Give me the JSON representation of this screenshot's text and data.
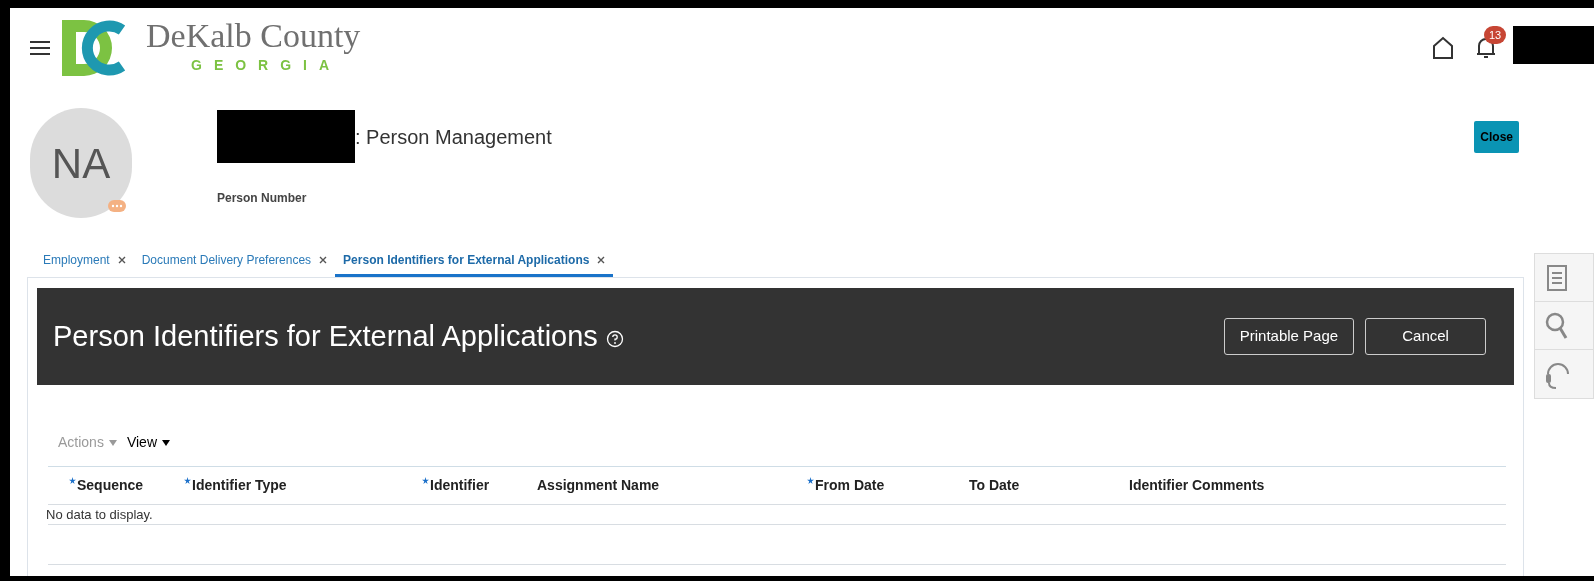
{
  "header": {
    "logo": {
      "name": "DeKalb County",
      "state": "GEORGIA"
    },
    "notifications": {
      "count": "13"
    }
  },
  "person": {
    "initials": "NA",
    "title": ": Person Management",
    "number_label": "Person Number",
    "close_button": "Close"
  },
  "tabs": [
    {
      "label": "Employment",
      "selected": false
    },
    {
      "label": "Document Delivery Preferences",
      "selected": false
    },
    {
      "label": "Person Identifiers for External Applications",
      "selected": true
    }
  ],
  "page": {
    "title": "Person Identifiers for External Applications",
    "buttons": [
      "Printable Page",
      "Cancel"
    ]
  },
  "toolbar": {
    "actions": {
      "label": "Actions",
      "disabled": true
    },
    "view": {
      "label": "View",
      "disabled": false
    }
  },
  "table": {
    "columns": [
      {
        "label": "Sequence",
        "required": true
      },
      {
        "label": "Identifier Type",
        "required": true
      },
      {
        "label": "Identifier",
        "required": true
      },
      {
        "label": "Assignment Name",
        "required": false
      },
      {
        "label": "From Date",
        "required": true
      },
      {
        "label": "To Date",
        "required": false
      },
      {
        "label": "Identifier Comments",
        "required": false
      }
    ],
    "empty_message": "No data to display."
  }
}
